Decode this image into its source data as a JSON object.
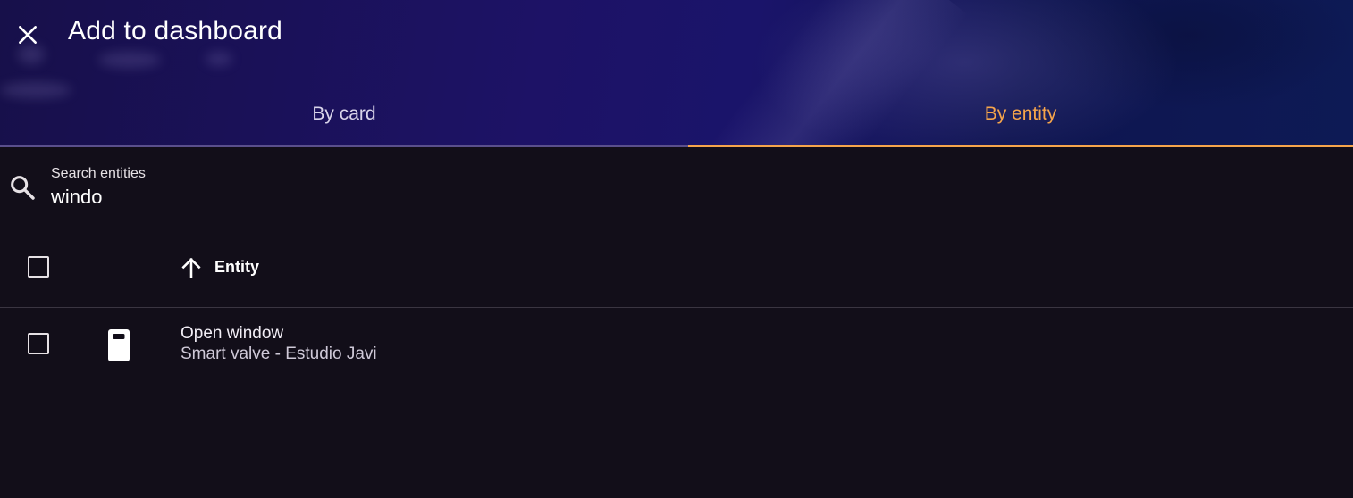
{
  "dialog": {
    "title": "Add to dashboard",
    "close_icon": "close-icon"
  },
  "tabs": [
    {
      "label": "By card",
      "active": false
    },
    {
      "label": "By entity",
      "active": true
    }
  ],
  "search": {
    "label": "Search entities",
    "value": "windo",
    "icon": "search-icon"
  },
  "table": {
    "header": {
      "sort_icon": "arrow-up-icon",
      "column_label": "Entity"
    },
    "rows": [
      {
        "icon": "valve-device-icon",
        "name": "Open window",
        "device": "Smart valve - Estudio Javi"
      }
    ]
  },
  "colors": {
    "accent": "#f6a54b",
    "background": "#120e19",
    "header_gradient_start": "#17104a",
    "header_gradient_end": "#0d1a55"
  }
}
